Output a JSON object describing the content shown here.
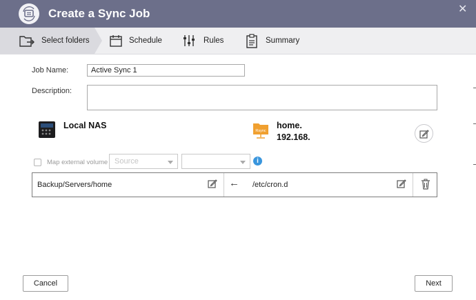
{
  "window": {
    "title": "Create a Sync Job",
    "icon": "sync-app-icon",
    "close_icon": "close-icon"
  },
  "tabs": [
    {
      "label": "Select folders",
      "icon": "folder-sync-icon",
      "active": true
    },
    {
      "label": "Schedule",
      "icon": "calendar-icon",
      "active": false
    },
    {
      "label": "Rules",
      "icon": "sliders-icon",
      "active": false
    },
    {
      "label": "Summary",
      "icon": "clipboard-icon",
      "active": false
    }
  ],
  "form": {
    "job_name_label": "Job Name:",
    "job_name_value": "Active Sync 1",
    "description_label": "Description:",
    "description_value": ""
  },
  "locations": {
    "local": {
      "name": "Local NAS",
      "icon": "nas-device-icon"
    },
    "remote": {
      "name_line1": "home.",
      "name_line2": "192.168.",
      "icon": "rsync-folder-icon",
      "badge": "Rsync"
    }
  },
  "map_external": {
    "label": "Map external volume",
    "source_placeholder": "Source",
    "second_value": "",
    "checked": false
  },
  "folder_pair": {
    "source_path": "Backup/Servers/home",
    "direction_arrow": "←",
    "destination_path": "/etc/cron.d"
  },
  "footer": {
    "cancel_label": "Cancel",
    "next_label": "Next"
  },
  "colors": {
    "titlebar": "#6c6f8a",
    "tabbar": "#efeff1",
    "active_tab": "#dadadf",
    "info_blue": "#3a96dd",
    "rsync_orange": "#f0a030"
  }
}
